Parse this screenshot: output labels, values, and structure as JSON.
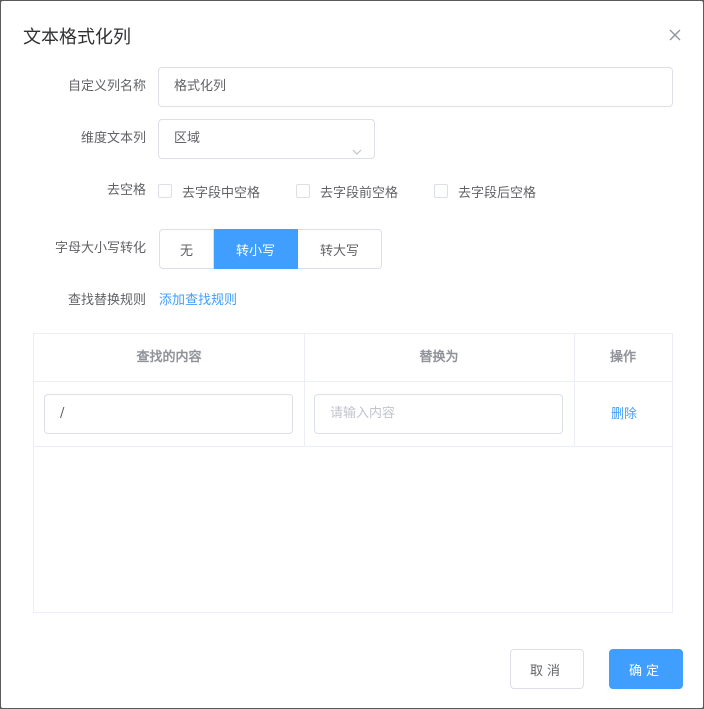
{
  "dialog": {
    "title": "文本格式化列",
    "close_icon": "close-icon"
  },
  "form": {
    "column_name": {
      "label": "自定义列名称",
      "value": "格式化列"
    },
    "dimension_column": {
      "label": "维度文本列",
      "value": "区域"
    },
    "trim": {
      "label": "去空格",
      "options": [
        "去字段中空格",
        "去字段前空格",
        "去字段后空格"
      ],
      "checked": [
        false,
        false,
        false
      ]
    },
    "case": {
      "label": "字母大小写转化",
      "options": [
        "无",
        "转小写",
        "转大写"
      ],
      "selected": "转小写"
    },
    "replace_rules": {
      "label": "查找替换规则",
      "add_link": "添加查找规则"
    }
  },
  "table": {
    "headers": [
      "查找的内容",
      "替换为",
      "操作"
    ],
    "rows": [
      {
        "find": "/",
        "replace_placeholder": "请输入内容",
        "replace": "",
        "action": "删除"
      }
    ]
  },
  "footer": {
    "cancel": "取消",
    "ok": "确定"
  },
  "colors": {
    "primary": "#409eff",
    "border": "#dcdfe6",
    "text": "#606266"
  }
}
